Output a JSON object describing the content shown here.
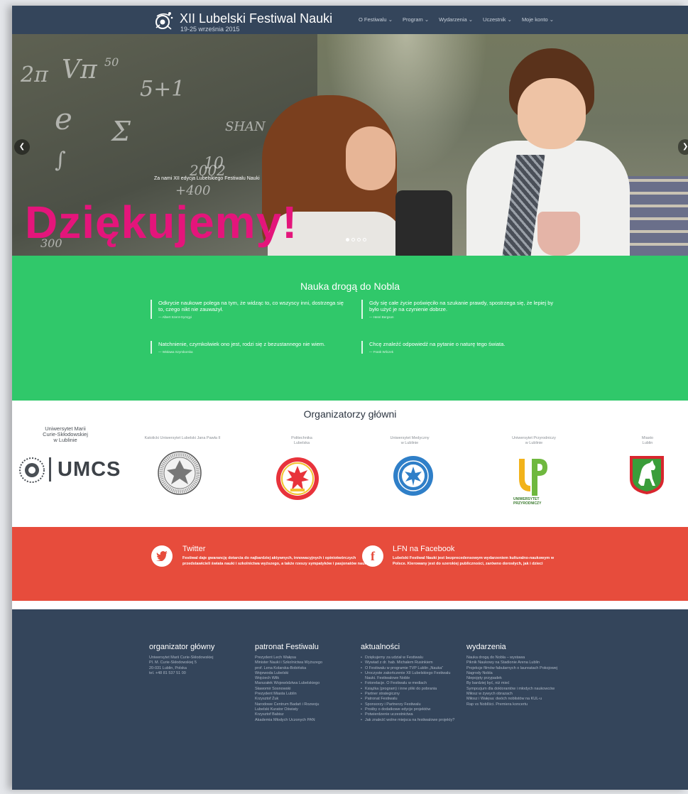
{
  "header": {
    "logo_icon": "festival-logo-icon",
    "title": "XII Lubelski Festiwal Nauki",
    "date": "19-25 września 2015",
    "nav": [
      "O Festiwalu",
      "Program",
      "Wydarzenia",
      "Uczestnik",
      "Moje konto"
    ]
  },
  "hero": {
    "caption": "Za nami XII edycja Lubelskiego Festiwalu Nauki",
    "headline": "Dziękujemy!",
    "prev_icon": "chevron-left-icon",
    "next_icon": "chevron-right-icon",
    "slide_count": 4,
    "active_slide": 1,
    "chalk": [
      "2π",
      "Vπ",
      "50",
      "5+1",
      "e",
      "Σ",
      "SHAN",
      "10",
      "∫",
      "2002",
      "+400",
      "300"
    ]
  },
  "quotes": {
    "title": "Nauka drogą do Nobla",
    "items": [
      {
        "text": "Odkrycie naukowe polega na tym, że widząc to, co wszyscy inni, dostrzega się to, czego nikt nie zauważył.",
        "author": "— Albert Szent-Györgyi"
      },
      {
        "text": "Gdy się całe życie poświęciło na szukanie prawdy, spostrzega się, że lepiej by było użyć je na czynienie dobrze.",
        "author": "— Henri Bergson"
      },
      {
        "text": "Natchnienie, czymkolwiek ono jest, rodzi się z bezustannego nie wiem.",
        "author": "— Wisława Szymborska"
      },
      {
        "text": "Chcę znaleźć odpowiedź na pytanie o naturę tego świata.",
        "author": "— Frank Wilczek"
      }
    ]
  },
  "organizers": {
    "title": "Organizatorzy główni",
    "items": [
      {
        "name": "Uniwersytet Marii\nCurie-Skłodowskiej\nw Lublinie",
        "logo_text": "UMCS",
        "logo_icon": "umcs-logo-icon"
      },
      {
        "name": "Katolicki Uniwersytet Lubelski Jana Pawła II",
        "logo_icon": "kul-seal-icon"
      },
      {
        "name": "Politechnika\nLubelska",
        "logo_icon": "politechnika-eagle-icon"
      },
      {
        "name": "Uniwersytet Medyczny\nw Lublinie",
        "logo_icon": "umlub-seal-icon"
      },
      {
        "name": "Uniwersytet Przyrodniczy\nw Lublinie",
        "logo_text": "UNIWERSYTET\nPRZYRODNICZY",
        "logo_icon": "up-logo-icon"
      },
      {
        "name": "Miasto\nLublin",
        "logo_icon": "lublin-coat-of-arms-icon"
      }
    ]
  },
  "social": {
    "twitter": {
      "icon": "twitter-icon",
      "title": "Twitter",
      "text": "Festiwal daje gwarancję dotarcia do najbardziej aktywnych, innowacyjnych i opiniotwórczych przedstawicieli świata nauki i szkolnictwa wyższego, a także rzeszy sympatyków i pasjonatów nauki"
    },
    "facebook": {
      "icon": "facebook-icon",
      "title": "LFN na Facebook",
      "text": "Lubelski Festiwal Nauki jest bezprecedensowym wydarzeniem kulturalno-naukowym w Polsce. Kierowany jest do szerokiej publiczności, zarówno dorosłych, jak i dzieci"
    }
  },
  "footer": {
    "organizer": {
      "title": "organizator główny",
      "lines": [
        "Uniwersytet Marii Curie-Skłodowskiej",
        "Pl. M. Curie-Skłodowskiej 5",
        "20-031 Lublin, Polska",
        "tel. +48 81 537 51 00"
      ]
    },
    "patronat": {
      "title": "patronat Festiwalu",
      "lines": [
        "Prezydent Lech Wałęsa",
        "Minister Nauki i Szkolnictwa Wyższego",
        "prof. Lena Kolarska-Bobińska",
        "Wojewoda Lubelski",
        "Wojciech Wilk",
        "Marszałek Województwa Lubelskiego",
        "Sławomir Sosnowski",
        "Prezydent Miasta Lublin",
        "Krzysztof Żuk",
        "Narodowe Centrum Badań i Rozwoju",
        "Lubelski Kurator Oświaty",
        "Krzysztof Babisz",
        "Akademia Młodych Uczonych PAN"
      ]
    },
    "aktualnosci": {
      "title": "aktualności",
      "items": [
        "Dziękujemy za udział w Festiwalu",
        "Wywiad z dr. hab. Michałem Rusinkiem",
        "O Festiwalu w programie TVP Lublin „Nauka”",
        "Uroczyste zakończenie XII Lubelskiego Festiwalu Nauki. Festiwalowe Noble",
        "Fotorelacje. O Festiwalu w mediach",
        "Książka (program) i inne pliki do pobrania",
        "Partner strategiczny",
        "Patronat Festiwalu",
        "Sponsorzy i Partnerzy Festiwalu",
        "Prośby o dodatkowe edycje projektów",
        "Potwierdzenie uczestnictwa",
        "Jak znaleźć wolne miejsca na festiwalowe projekty?"
      ]
    },
    "wydarzenia": {
      "title": "wydarzenia",
      "lines": [
        "Nauka drogą do Nobla – wystawa",
        "Piknik Naukowy na Stadionie Arena Lublin",
        "Projekcje filmów fabularnych o laureatach Pokojowej Nagrody Nobla",
        "Niepojęty przypadek",
        "By bardziej być, niż mieć",
        "Sympozjum dla doktorantów i młodych naukowców",
        "Miłosz w żywych obrazach",
        "Miłosz i Wałęsa: dwóch noblistów na KUL-u",
        "Rap vs Noblīści. Premiera koncertu"
      ]
    }
  },
  "colors": {
    "header_bg": "#34455b",
    "accent_pink": "#e4157b",
    "quotes_bg": "#30c86a",
    "social_bg": "#e74c3c",
    "footer_bg": "#34455b"
  }
}
